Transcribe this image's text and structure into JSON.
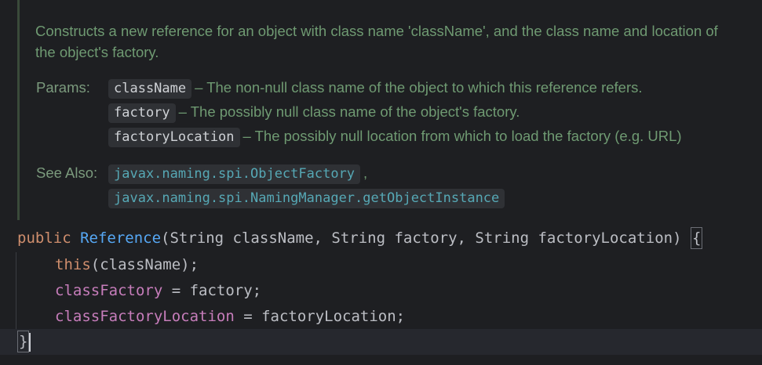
{
  "doc": {
    "description": "Constructs a new reference for an object with class name 'className', and the class name and location of the object's factory.",
    "params_label": "Params:",
    "params": [
      {
        "name": "className",
        "text": "– The non-null class name of the object to which this reference refers."
      },
      {
        "name": "factory",
        "text": "– The possibly null class name of the object's factory."
      },
      {
        "name": "factoryLocation",
        "text": "– The possibly null location from which to load the factory (e.g. URL)"
      }
    ],
    "see_also_label": "See Also:",
    "see_also": [
      {
        "text": "javax.naming.spi.ObjectFactory",
        "suffix": ","
      },
      {
        "text": "javax.naming.spi.NamingManager.getObjectInstance",
        "suffix": ""
      }
    ]
  },
  "code": {
    "line1": {
      "kw": "public",
      "fn": "Reference",
      "rest": "(String className, String factory, String factoryLocation) ",
      "brace": "{"
    },
    "line2": {
      "kw": "this",
      "rest": "(className);"
    },
    "line3": {
      "field": "classFactory",
      "rest": " = factory;"
    },
    "line4": {
      "field": "classFactoryLocation",
      "rest": " = factoryLocation;"
    },
    "line5": {
      "brace": "}"
    }
  },
  "colors": {
    "background": "#1e1f22",
    "doc_text": "#6f9a72",
    "keyword": "#cf8e6d",
    "function": "#56a8f5",
    "field": "#c77dbb",
    "link": "#56a8b5"
  }
}
